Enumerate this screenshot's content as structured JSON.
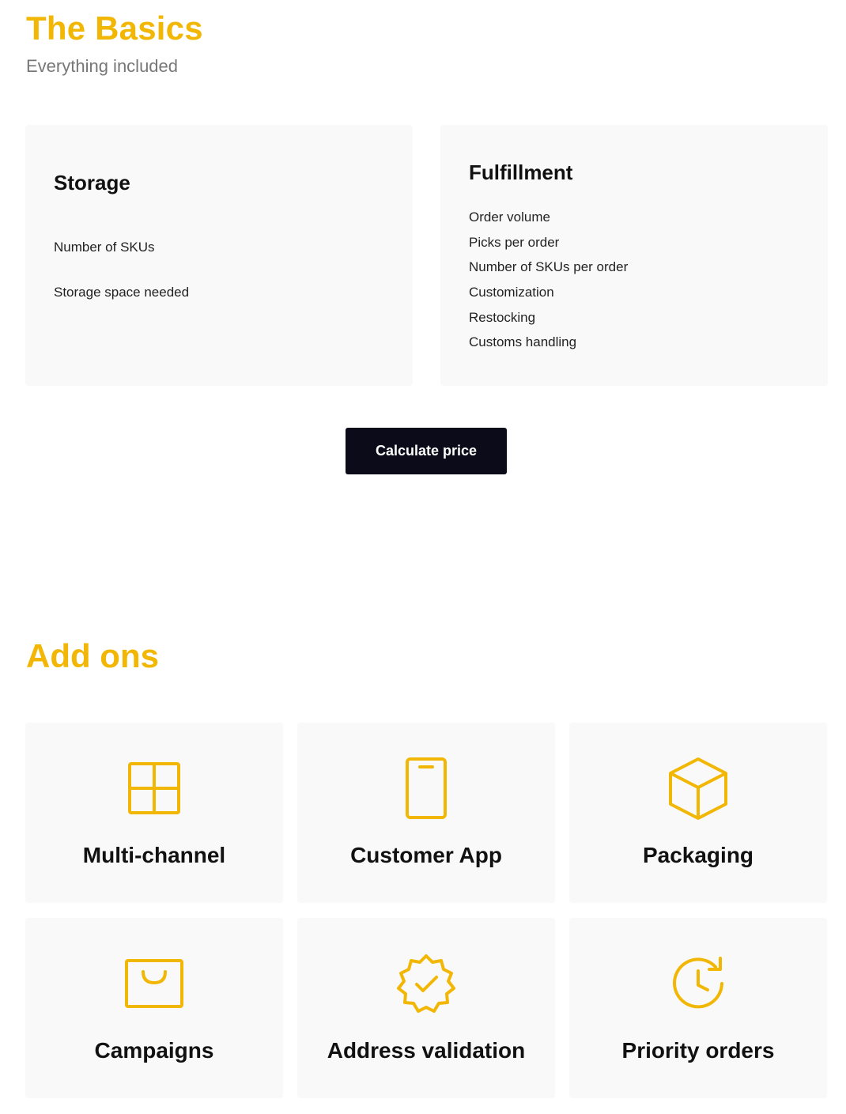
{
  "basics": {
    "title": "The Basics",
    "subtitle": "Everything included"
  },
  "storage": {
    "heading": "Storage",
    "items": [
      "Number of SKUs",
      "Storage space needed"
    ]
  },
  "fulfillment": {
    "heading": "Fulfillment",
    "items": [
      "Order volume",
      "Picks per order",
      "Number of SKUs per order",
      "Customization",
      "Restocking",
      "Customs handling"
    ]
  },
  "calculate_button": {
    "label": "Calculate price"
  },
  "addons": {
    "title": "Add ons",
    "cards": [
      {
        "label": "Multi-channel",
        "icon": "grid-icon"
      },
      {
        "label": "Customer App",
        "icon": "phone-icon"
      },
      {
        "label": "Packaging",
        "icon": "box-icon"
      },
      {
        "label": "Campaigns",
        "icon": "shopping-bag-icon"
      },
      {
        "label": "Address validation",
        "icon": "verified-badge-icon"
      },
      {
        "label": "Priority orders",
        "icon": "clock-refresh-icon"
      }
    ]
  },
  "colors": {
    "accent": "#F2B705",
    "panel_bg": "#F9F9F9",
    "button_bg": "#0B0B1A",
    "subtitle": "#777777"
  }
}
